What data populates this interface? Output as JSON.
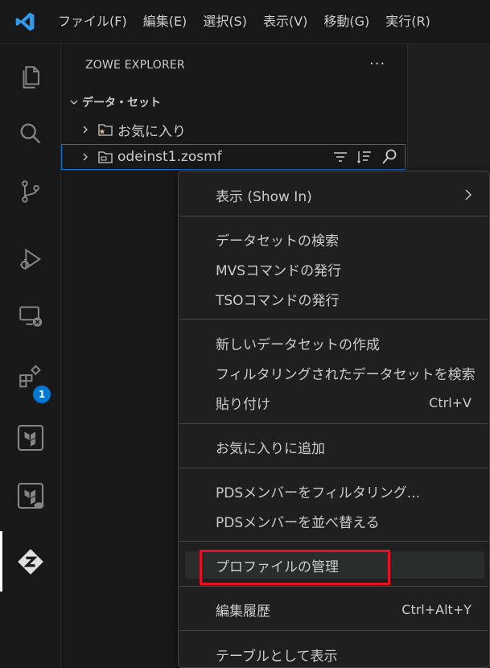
{
  "menubar": {
    "items": [
      "ファイル(F)",
      "編集(E)",
      "選択(S)",
      "表示(V)",
      "移動(G)",
      "実行(R)"
    ]
  },
  "activity_bar": {
    "extensions_badge": "1"
  },
  "sidebar": {
    "title": "ZOWE EXPLORER",
    "more_label": "···",
    "section": "データ・セット",
    "tree": [
      {
        "label": "お気に入り"
      },
      {
        "label": "odeinst1.zosmf"
      }
    ]
  },
  "context_menu": {
    "items": [
      {
        "label": "表示 (Show In)"
      },
      {
        "label": "データセットの検索"
      },
      {
        "label": "MVSコマンドの発行"
      },
      {
        "label": "TSOコマンドの発行"
      },
      {
        "label": "新しいデータセットの作成"
      },
      {
        "label": "フィルタリングされたデータセットを検索"
      },
      {
        "label": "貼り付け",
        "keybind": "Ctrl+V"
      },
      {
        "label": "お気に入りに追加"
      },
      {
        "label": "PDSメンバーをフィルタリング..."
      },
      {
        "label": "PDSメンバーを並べ替える"
      },
      {
        "label": "プロファイルの管理"
      },
      {
        "label": "編集履歴",
        "keybind": "Ctrl+Alt+Y"
      },
      {
        "label": "テーブルとして表示"
      }
    ]
  },
  "colors": {
    "accent": "#0078d4",
    "highlight": "#e81123",
    "favorite_star": "#e2c08d"
  }
}
